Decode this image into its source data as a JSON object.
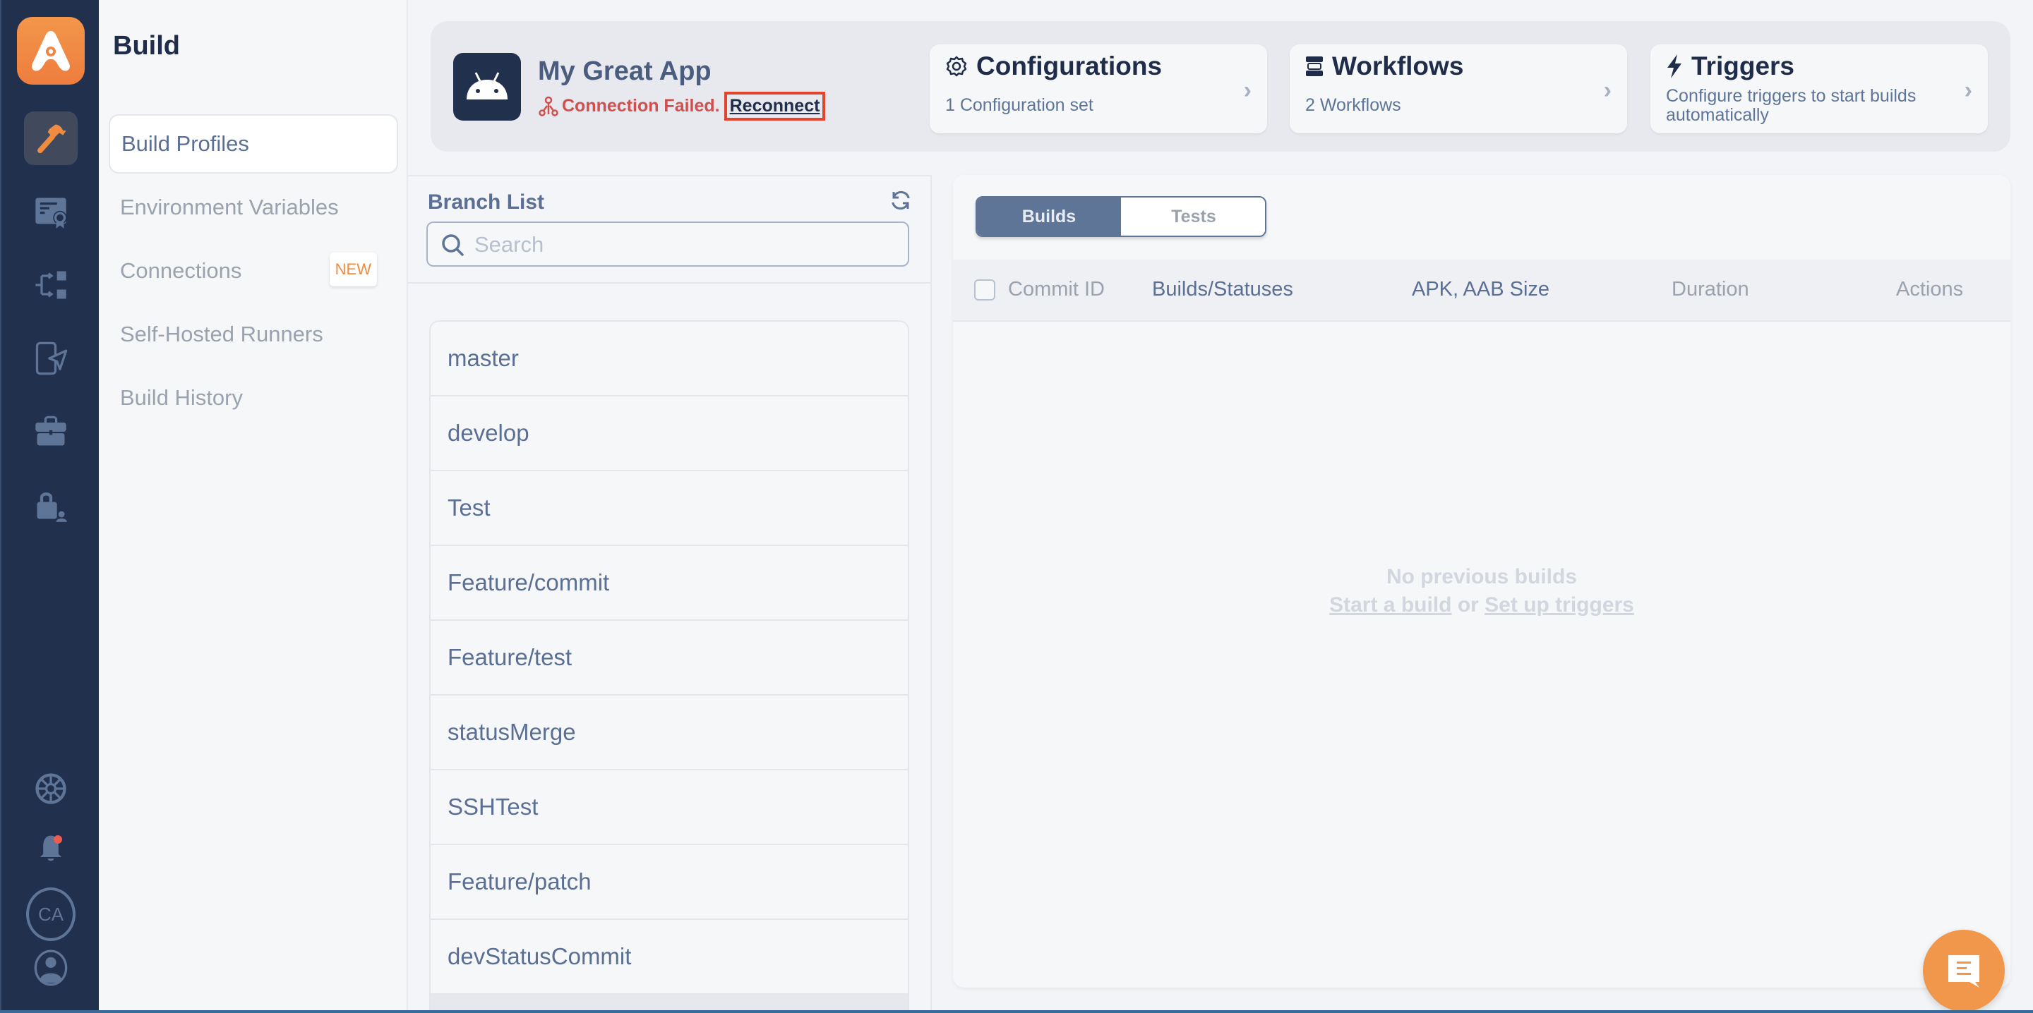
{
  "rail": {
    "items": [
      {
        "icon": "hammer-icon",
        "active": true
      },
      {
        "icon": "certificate-icon",
        "active": false
      },
      {
        "icon": "workflow-icon",
        "active": false
      },
      {
        "icon": "app-distribution-icon",
        "active": false
      },
      {
        "icon": "briefcase-icon",
        "active": false
      },
      {
        "icon": "lock-user-icon",
        "active": false
      }
    ],
    "bottom": {
      "help": "help-icon",
      "notifications": "bell-icon",
      "avatar_initials": "CA",
      "profile": "user-icon"
    }
  },
  "subnav": {
    "title": "Build",
    "items": [
      {
        "label": "Build Profiles",
        "active": true
      },
      {
        "label": "Environment Variables",
        "active": false
      },
      {
        "label": "Connections",
        "active": false,
        "badge": "NEW"
      },
      {
        "label": "Self-Hosted Runners",
        "active": false
      },
      {
        "label": "Build History",
        "active": false
      }
    ]
  },
  "header": {
    "app_name": "My Great App",
    "connection_status": "Connection Failed.",
    "reconnect_label": "Reconnect",
    "cards": [
      {
        "title": "Configurations",
        "subtitle": "1 Configuration set",
        "icon": "gear-icon"
      },
      {
        "title": "Workflows",
        "subtitle": "2 Workflows",
        "icon": "workflow-list-icon"
      },
      {
        "title": "Triggers",
        "subtitle": "Configure triggers to start builds automatically",
        "icon": "lightning-icon"
      }
    ]
  },
  "branches": {
    "title": "Branch List",
    "search_placeholder": "Search",
    "search_value": "",
    "items": [
      "master",
      "develop",
      "Test",
      "Feature/commit",
      "Feature/test",
      "statusMerge",
      "SSHTest",
      "Feature/patch",
      "devStatusCommit"
    ]
  },
  "builds": {
    "tabs": [
      {
        "label": "Builds",
        "active": true
      },
      {
        "label": "Tests",
        "active": false
      }
    ],
    "columns": [
      "Commit ID",
      "Builds/Statuses",
      "APK, AAB Size",
      "Duration",
      "Actions"
    ],
    "empty_title": "No previous builds",
    "empty_action_1": "Start a build",
    "empty_connector": "or",
    "empty_action_2": "Set up triggers"
  },
  "colors": {
    "brand": "#f0974b",
    "rail_bg": "#21304d",
    "error": "#d0504f",
    "accent": "#5e7597"
  }
}
